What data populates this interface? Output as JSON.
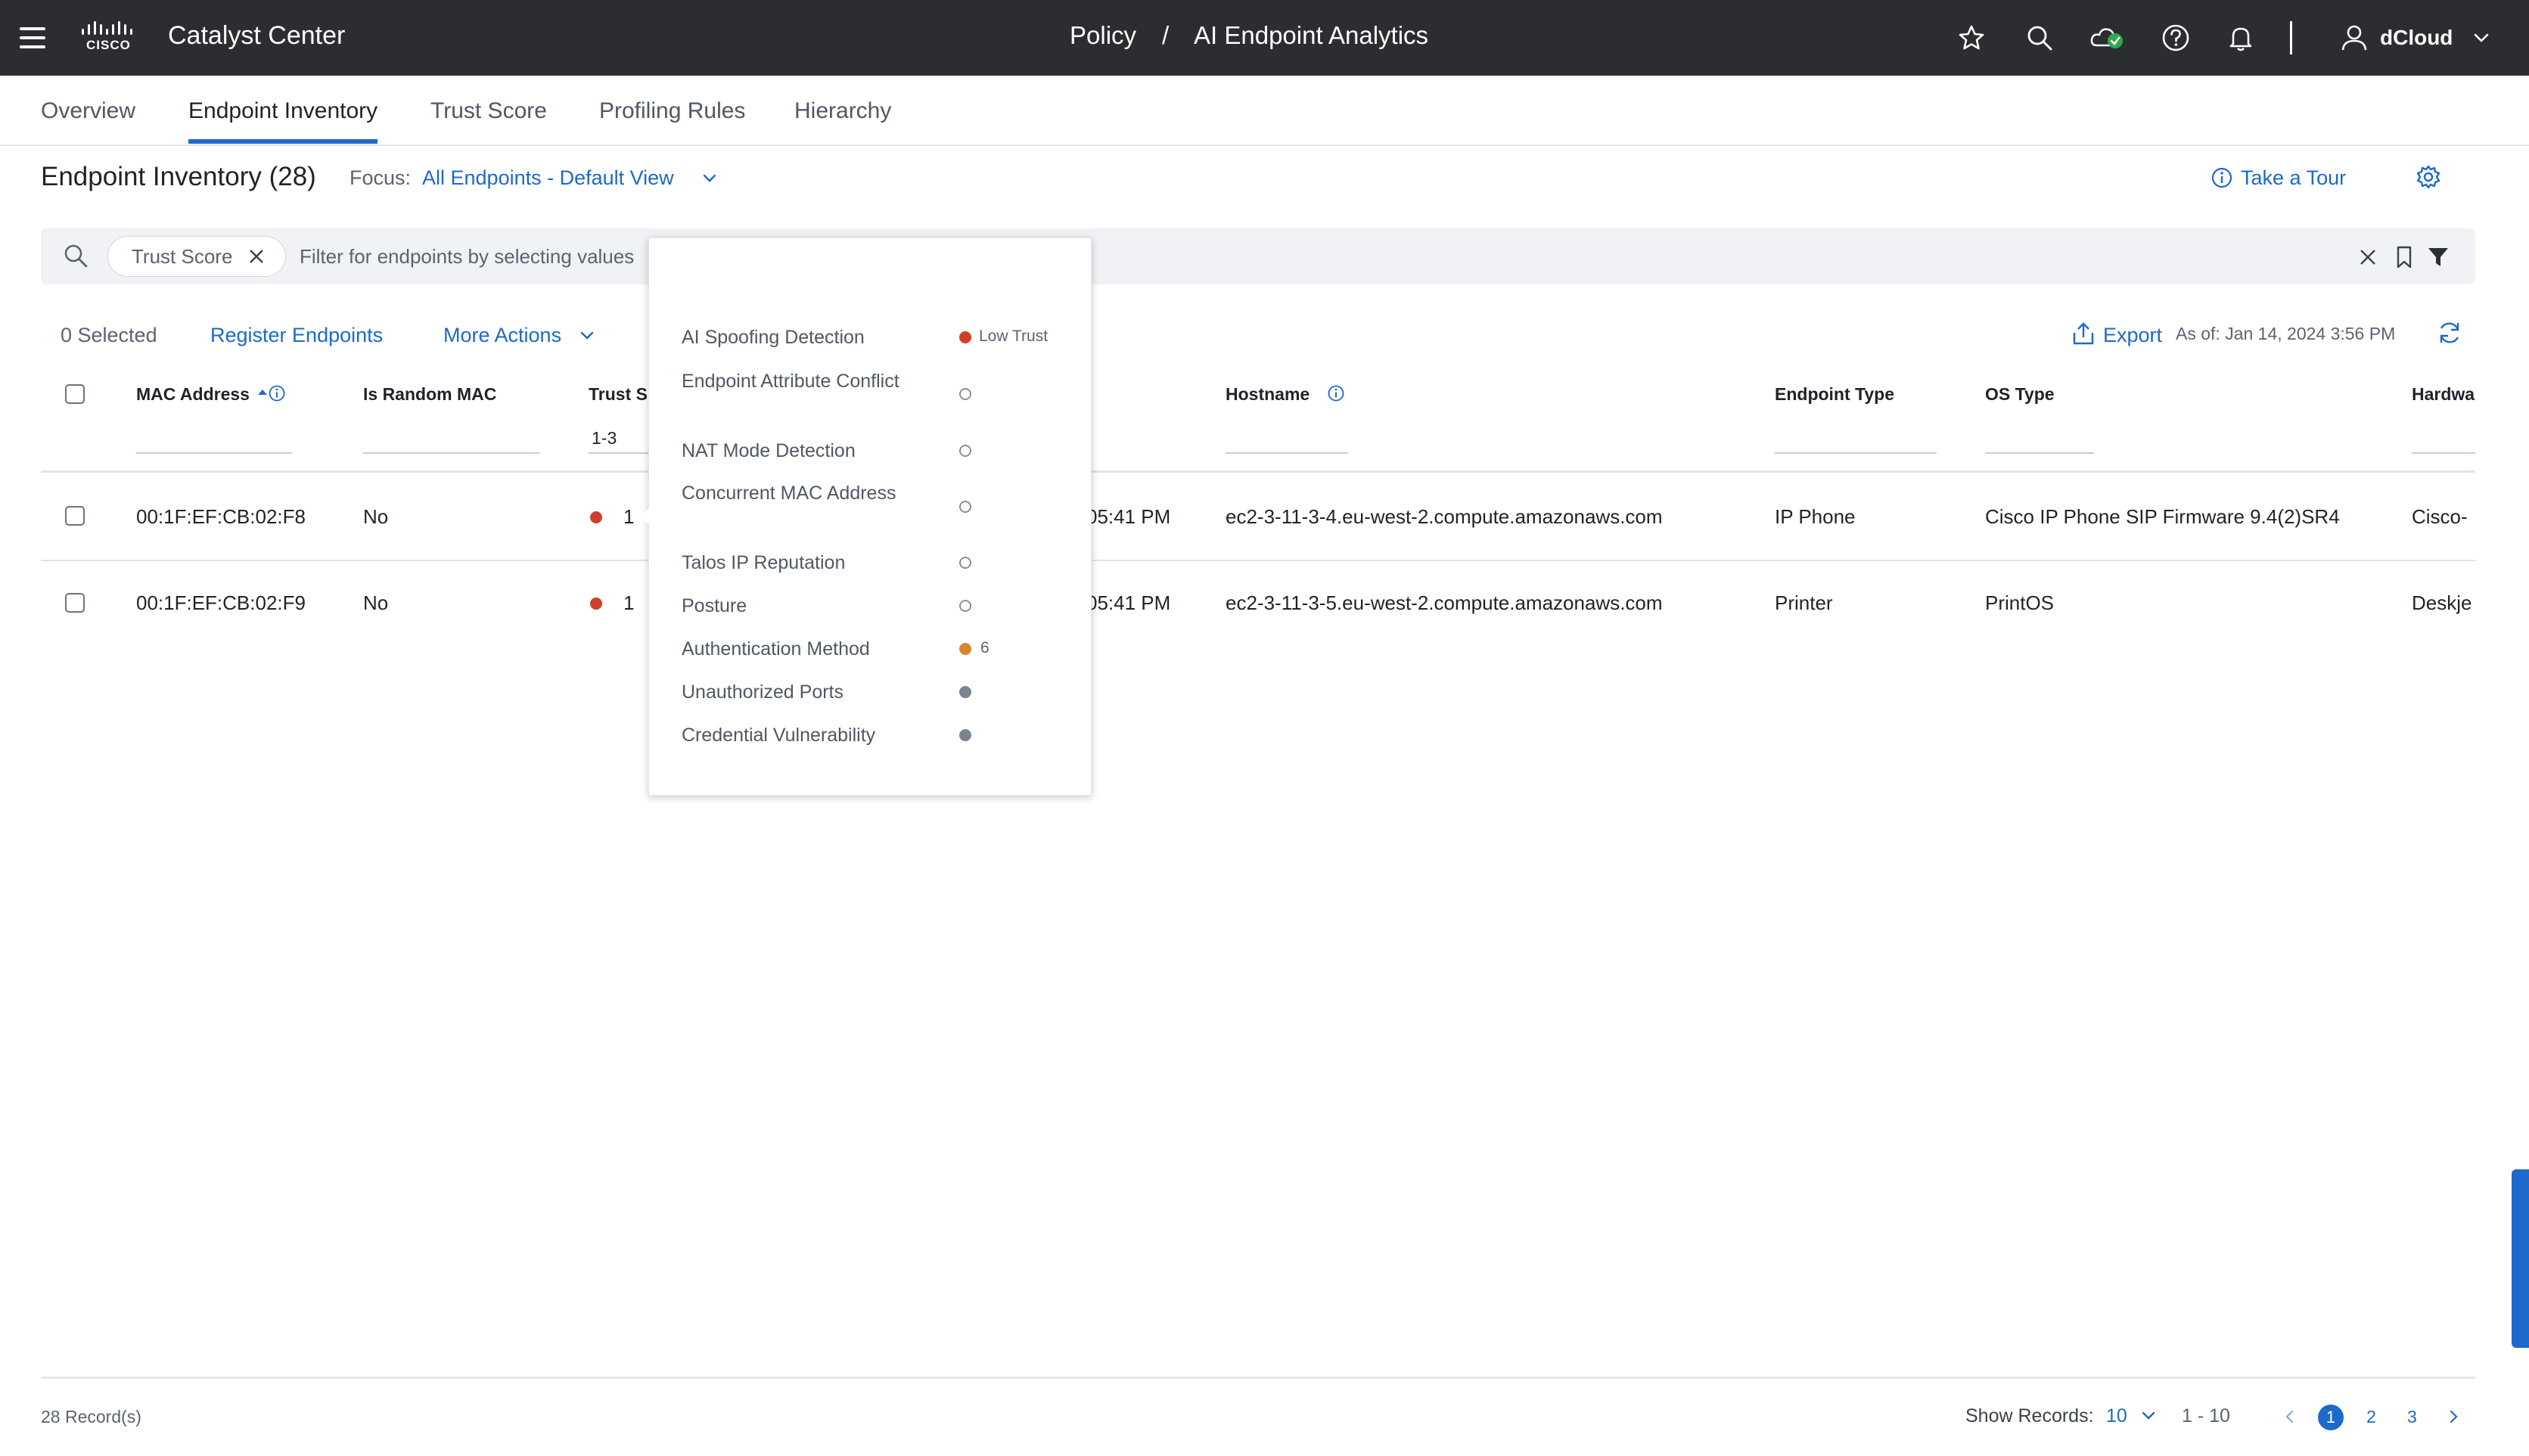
{
  "header": {
    "app_title": "Catalyst Center",
    "brand_text": "CISCO",
    "breadcrumb_root": "Policy",
    "breadcrumb_sep": "/",
    "breadcrumb_page": "AI Endpoint Analytics",
    "user_name": "dCloud"
  },
  "tabs": [
    "Overview",
    "Endpoint Inventory",
    "Trust Score",
    "Profiling Rules",
    "Hierarchy"
  ],
  "page": {
    "title": "Endpoint Inventory (28)",
    "focus_label": "Focus:",
    "focus_value": "All Endpoints - Default View",
    "tour_label": "Take a Tour"
  },
  "filter": {
    "chip_label": "Trust Score",
    "placeholder": "Filter for endpoints by selecting values"
  },
  "actions": {
    "selected": "0 Selected",
    "register": "Register Endpoints",
    "more": "More Actions",
    "export": "Export",
    "as_of": "As of: Jan 14, 2024 3:56 PM"
  },
  "table": {
    "columns": {
      "mac": "MAC Address",
      "random": "Is Random MAC",
      "trust": "Trust S",
      "hostname": "Hostname",
      "type": "Endpoint Type",
      "os": "OS Type",
      "hardware": "Hardwa"
    },
    "trust_filter_value": "1-3",
    "rows": [
      {
        "mac": "00:1F:EF:CB:02:F8",
        "random": "No",
        "trust": "1",
        "time": "05:41 PM",
        "hostname": "ec2-3-11-3-4.eu-west-2.compute.amazonaws.com",
        "type": "IP Phone",
        "os": "Cisco IP Phone SIP Firmware 9.4(2)SR4",
        "hardware": "Cisco-"
      },
      {
        "mac": "00:1F:EF:CB:02:F9",
        "random": "No",
        "trust": "1",
        "time": "05:41 PM",
        "hostname": "ec2-3-11-3-5.eu-west-2.compute.amazonaws.com",
        "type": "Printer",
        "os": "PrintOS",
        "hardware": "Deskje"
      }
    ]
  },
  "popup": {
    "items": [
      {
        "label": "AI Spoofing Detection",
        "status": "red",
        "value": "Low Trust"
      },
      {
        "label": "Endpoint Attribute Conflict",
        "status": "ring",
        "value": ""
      },
      {
        "label": "NAT Mode Detection",
        "status": "ring",
        "value": ""
      },
      {
        "label": "Concurrent MAC Address",
        "status": "ring",
        "value": ""
      },
      {
        "label": "Talos IP Reputation",
        "status": "ring",
        "value": ""
      },
      {
        "label": "Posture",
        "status": "ring",
        "value": ""
      },
      {
        "label": "Authentication Method",
        "status": "orange",
        "value": "6"
      },
      {
        "label": "Unauthorized Ports",
        "status": "grey",
        "value": ""
      },
      {
        "label": "Credential Vulnerability",
        "status": "grey",
        "value": ""
      }
    ]
  },
  "footer": {
    "records": "28 Record(s)",
    "show_records_label": "Show Records:",
    "show_records_value": "10",
    "range": "1 - 10",
    "pages": [
      "1",
      "2",
      "3"
    ]
  },
  "colors": {
    "topbar": "#2b2d31",
    "accent_blue": "#1d69cc",
    "low_trust_red": "#cf3f2a",
    "medium_orange": "#d6872b",
    "status_green": "#2fa84f"
  }
}
